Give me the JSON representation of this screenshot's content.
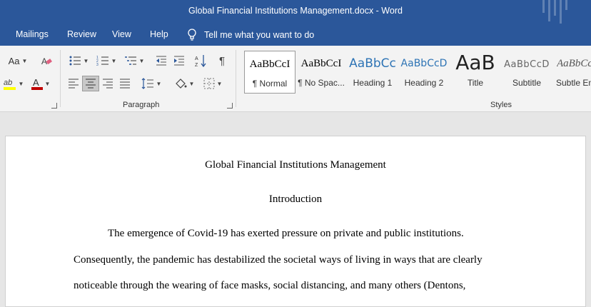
{
  "window": {
    "title": "Global Financial Institutions Management.docx  -  Word"
  },
  "tabs": [
    "Mailings",
    "Review",
    "View",
    "Help"
  ],
  "tell_me": "Tell me what you want to do",
  "ribbon": {
    "font_group": {
      "change_case": "Aa",
      "highlight_color": "#ffff00",
      "font_color": "#c00000"
    },
    "paragraph_group": {
      "label": "Paragraph",
      "show_marks": "¶"
    },
    "styles_group": {
      "label": "Styles",
      "styles": [
        {
          "sample": "AaBbCcI",
          "name": "¶ Normal"
        },
        {
          "sample": "AaBbCcI",
          "name": "¶ No Spac..."
        },
        {
          "sample": "AaBbCc",
          "name": "Heading 1"
        },
        {
          "sample": "AaBbCcD",
          "name": "Heading 2"
        },
        {
          "sample": "AaB",
          "name": "Title"
        },
        {
          "sample": "AaBbCcD",
          "name": "Subtitle"
        },
        {
          "sample": "AaBbCcI",
          "name": "Subtle Em"
        }
      ]
    }
  },
  "document": {
    "title": "Global Financial Institutions Management",
    "heading": "Introduction",
    "lines": [
      "The emergence of Covid-19 has exerted pressure on private and public institutions.",
      "Consequently, the pandemic has destabilized the societal ways of living in ways that are clearly",
      "noticeable through the wearing of face masks, social distancing, and many others (Dentons,"
    ]
  }
}
